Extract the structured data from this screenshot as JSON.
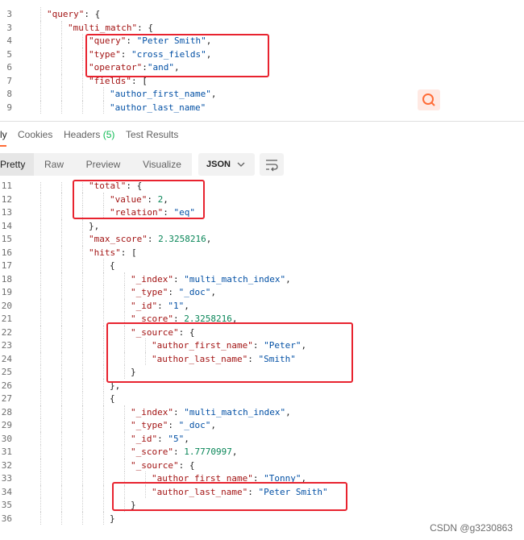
{
  "request": {
    "lines": [
      {
        "n": "3",
        "indent": 1,
        "html": "<span class=\"k\">\"query\"</span><span class=\"p\">: {</span>"
      },
      {
        "n": "3",
        "indent": 2,
        "html": "<span class=\"k\">\"multi_match\"</span><span class=\"p\">: {</span>"
      },
      {
        "n": "4",
        "indent": 3,
        "html": "<span class=\"k\">\"query\"</span><span class=\"p\">: </span><span class=\"s\">\"Peter Smith\"</span><span class=\"p\">,</span>"
      },
      {
        "n": "5",
        "indent": 3,
        "html": "<span class=\"k\">\"type\"</span><span class=\"p\">: </span><span class=\"s\">\"cross_fields\"</span><span class=\"p\">,</span>"
      },
      {
        "n": "6",
        "indent": 3,
        "html": "<span class=\"k\">\"operator\"</span><span class=\"p\">:</span><span class=\"s\">\"and\"</span><span class=\"p\">,</span>"
      },
      {
        "n": "7",
        "indent": 3,
        "html": "<span class=\"k\">\"fields\"</span><span class=\"p\">: [</span>"
      },
      {
        "n": "8",
        "indent": 4,
        "html": "<span class=\"s\">\"author_first_name\"</span><span class=\"p\">,</span>"
      },
      {
        "n": "9",
        "indent": 4,
        "html": "<span class=\"s\">\"author_last_name\"</span>"
      }
    ]
  },
  "tabs": {
    "body": "ly",
    "cookies": "Cookies",
    "headers": "Headers",
    "headers_count": "(5)",
    "test_results": "Test Results"
  },
  "toolbar": {
    "pretty": "Pretty",
    "raw": "Raw",
    "preview": "Preview",
    "visualize": "Visualize",
    "format": "JSON"
  },
  "response": {
    "lines": [
      {
        "n": "11",
        "indent": 3,
        "html": "<span class=\"k\">\"total\"</span><span class=\"p\">: {</span>"
      },
      {
        "n": "12",
        "indent": 4,
        "html": "<span class=\"k\">\"value\"</span><span class=\"p\">: </span><span class=\"n\">2</span><span class=\"p\">,</span>"
      },
      {
        "n": "13",
        "indent": 4,
        "html": "<span class=\"k\">\"relation\"</span><span class=\"p\">: </span><span class=\"s\">\"eq\"</span>"
      },
      {
        "n": "14",
        "indent": 3,
        "html": "<span class=\"p\">},</span>"
      },
      {
        "n": "15",
        "indent": 3,
        "html": "<span class=\"k\">\"max_score\"</span><span class=\"p\">: </span><span class=\"n\">2.3258216</span><span class=\"p\">,</span>"
      },
      {
        "n": "16",
        "indent": 3,
        "html": "<span class=\"k\">\"hits\"</span><span class=\"p\">: [</span>"
      },
      {
        "n": "17",
        "indent": 4,
        "html": "<span class=\"p\">{</span>"
      },
      {
        "n": "18",
        "indent": 5,
        "html": "<span class=\"k\">\"_index\"</span><span class=\"p\">: </span><span class=\"s\">\"multi_match_index\"</span><span class=\"p\">,</span>"
      },
      {
        "n": "19",
        "indent": 5,
        "html": "<span class=\"k\">\"_type\"</span><span class=\"p\">: </span><span class=\"s\">\"_doc\"</span><span class=\"p\">,</span>"
      },
      {
        "n": "20",
        "indent": 5,
        "html": "<span class=\"k\">\"_id\"</span><span class=\"p\">: </span><span class=\"s\">\"1\"</span><span class=\"p\">,</span>"
      },
      {
        "n": "21",
        "indent": 5,
        "html": "<span class=\"k\">\"_score\"</span><span class=\"p\">: </span><span class=\"n\">2.3258216</span><span class=\"p\">,</span>"
      },
      {
        "n": "22",
        "indent": 5,
        "html": "<span class=\"k\">\"_source\"</span><span class=\"p\">: {</span>"
      },
      {
        "n": "23",
        "indent": 6,
        "html": "<span class=\"k\">\"author_first_name\"</span><span class=\"p\">: </span><span class=\"s\">\"Peter\"</span><span class=\"p\">,</span>"
      },
      {
        "n": "24",
        "indent": 6,
        "html": "<span class=\"k\">\"author_last_name\"</span><span class=\"p\">: </span><span class=\"s\">\"Smith\"</span>"
      },
      {
        "n": "25",
        "indent": 5,
        "html": "<span class=\"p\">}</span>"
      },
      {
        "n": "26",
        "indent": 4,
        "html": "<span class=\"p\">},</span>"
      },
      {
        "n": "27",
        "indent": 4,
        "html": "<span class=\"p\">{</span>"
      },
      {
        "n": "28",
        "indent": 5,
        "html": "<span class=\"k\">\"_index\"</span><span class=\"p\">: </span><span class=\"s\">\"multi_match_index\"</span><span class=\"p\">,</span>"
      },
      {
        "n": "29",
        "indent": 5,
        "html": "<span class=\"k\">\"_type\"</span><span class=\"p\">: </span><span class=\"s\">\"_doc\"</span><span class=\"p\">,</span>"
      },
      {
        "n": "30",
        "indent": 5,
        "html": "<span class=\"k\">\"_id\"</span><span class=\"p\">: </span><span class=\"s\">\"5\"</span><span class=\"p\">,</span>"
      },
      {
        "n": "31",
        "indent": 5,
        "html": "<span class=\"k\">\"_score\"</span><span class=\"p\">: </span><span class=\"n\">1.7770997</span><span class=\"p\">,</span>"
      },
      {
        "n": "32",
        "indent": 5,
        "html": "<span class=\"k\">\"_source\"</span><span class=\"p\">: {</span>"
      },
      {
        "n": "33",
        "indent": 6,
        "html": "<span class=\"k\">\"author_first_name\"</span><span class=\"p\">: </span><span class=\"s\">\"Tonny\"</span><span class=\"p\">,</span>"
      },
      {
        "n": "34",
        "indent": 6,
        "html": "<span class=\"k\">\"author_last_name\"</span><span class=\"p\">: </span><span class=\"s\">\"Peter Smith\"</span>"
      },
      {
        "n": "35",
        "indent": 5,
        "html": "<span class=\"p\">}</span>"
      },
      {
        "n": "36",
        "indent": 4,
        "html": "<span class=\"p\">}</span>"
      }
    ]
  },
  "watermark": "CSDN @g3230863"
}
